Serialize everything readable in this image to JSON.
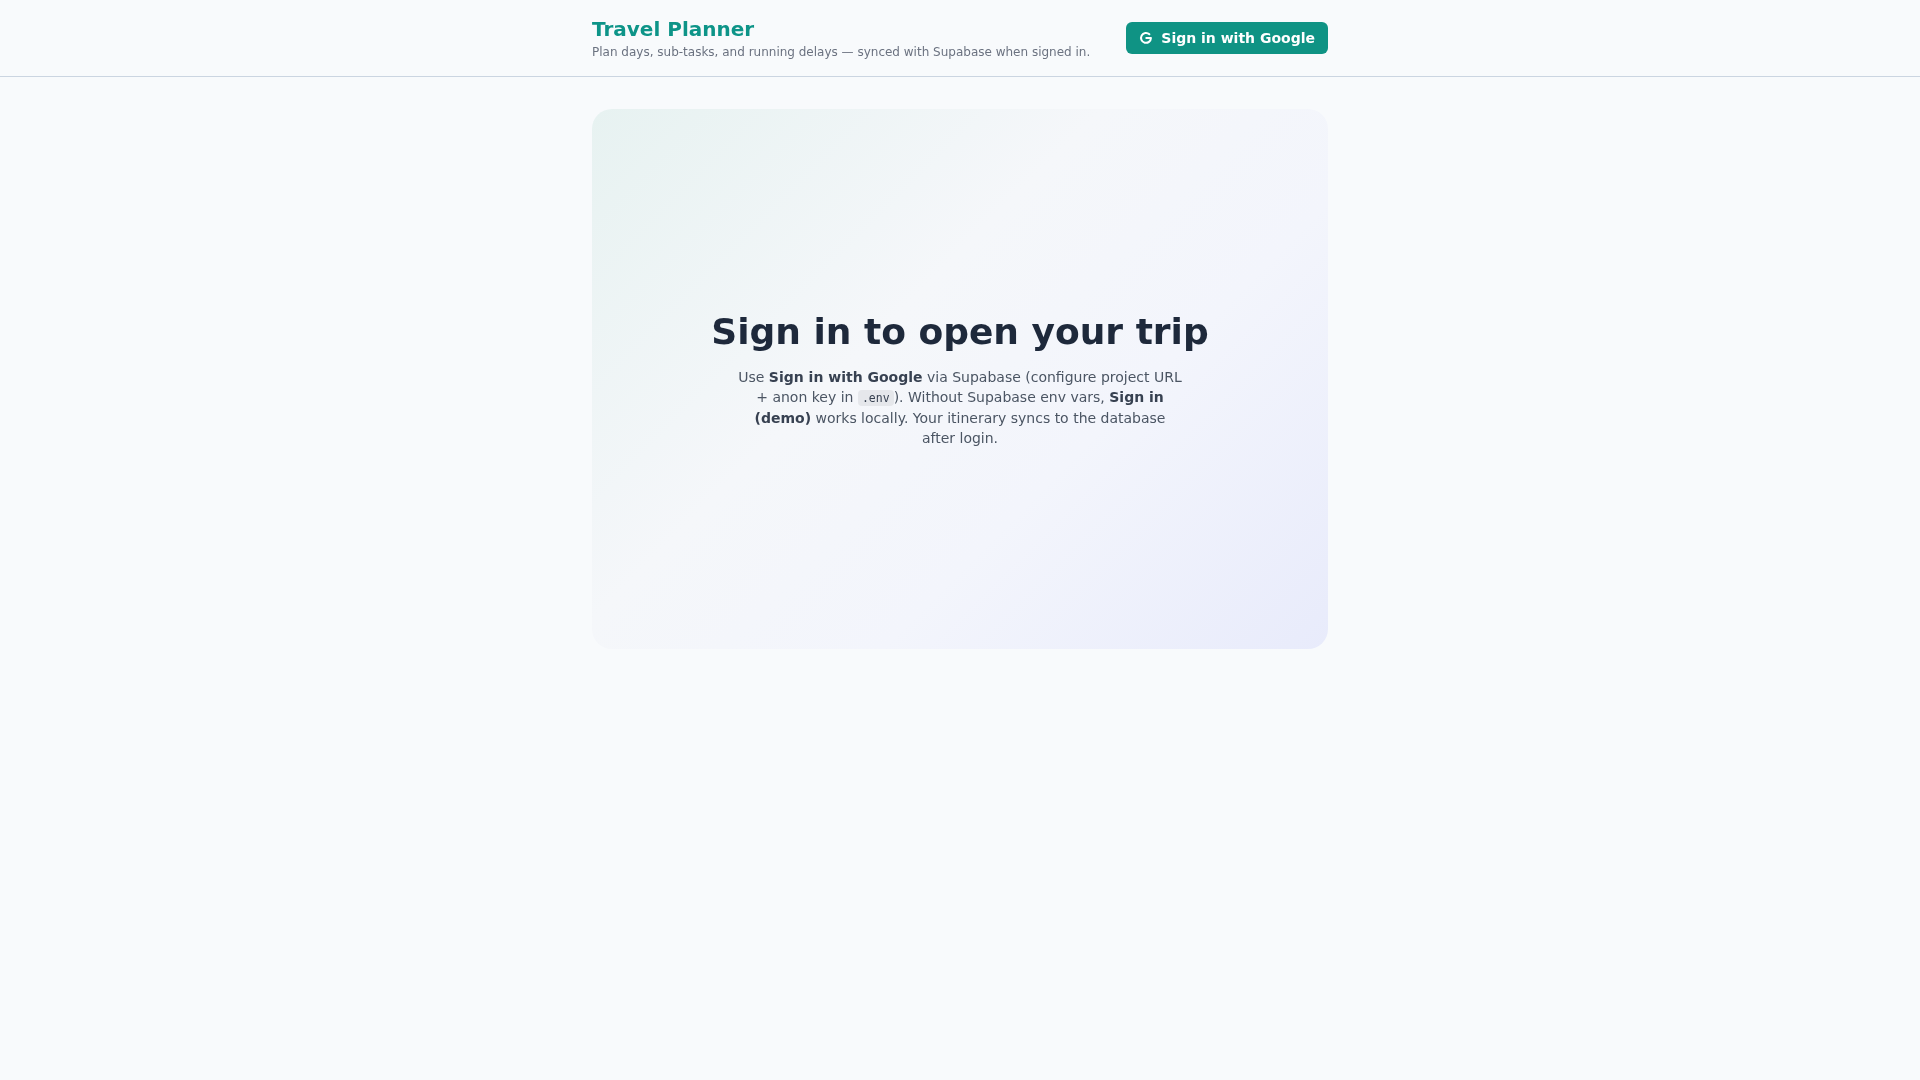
{
  "header": {
    "title": "Travel Planner",
    "subtitle": "Plan days, sub-tasks, and running delays — synced with Supabase when signed in.",
    "sign_in_button": {
      "label": "Sign in with Google"
    }
  },
  "card": {
    "heading": "Sign in to open your trip",
    "message": [
      {
        "kind": "text",
        "text": "Use **Sign in with Google** via Supabase (configure project URL + anon key in "
      },
      {
        "kind": "code",
        "text": ".env"
      },
      {
        "kind": "text",
        "text": "). Without Supabase env vars, **Sign in (demo)** works locally. Your itinerary syncs to the database after login."
      }
    ]
  }
}
